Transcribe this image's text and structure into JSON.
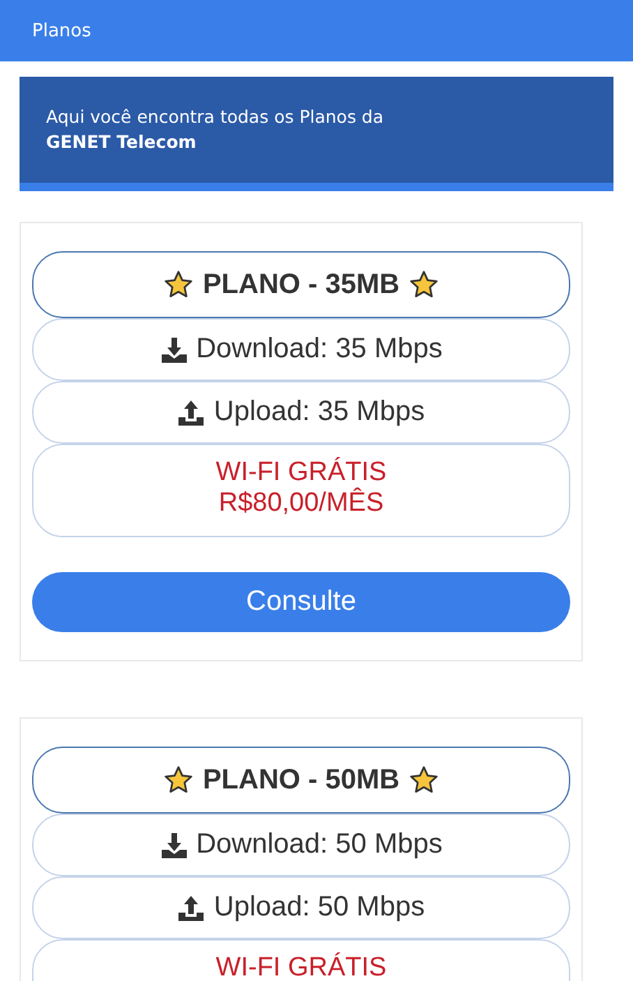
{
  "header": {
    "title": "Planos"
  },
  "banner": {
    "text": "Aqui você encontra todas os Planos da",
    "brand": "GENET Telecom"
  },
  "plans": [
    {
      "title": "PLANO - 35MB",
      "features": [
        {
          "kind": "download",
          "label": "Download: 35 Mbps"
        },
        {
          "kind": "upload",
          "label": "Upload: 35 Mbps"
        }
      ],
      "price_lines": [
        "WI-FI GRÁTIS",
        "R$80,00/MÊS"
      ],
      "button": "Consulte"
    },
    {
      "title": "PLANO - 50MB",
      "features": [
        {
          "kind": "download",
          "label": "Download: 50 Mbps"
        },
        {
          "kind": "upload",
          "label": "Upload: 50 Mbps"
        }
      ],
      "price_lines": [
        "WI-FI GRÁTIS"
      ]
    }
  ]
}
